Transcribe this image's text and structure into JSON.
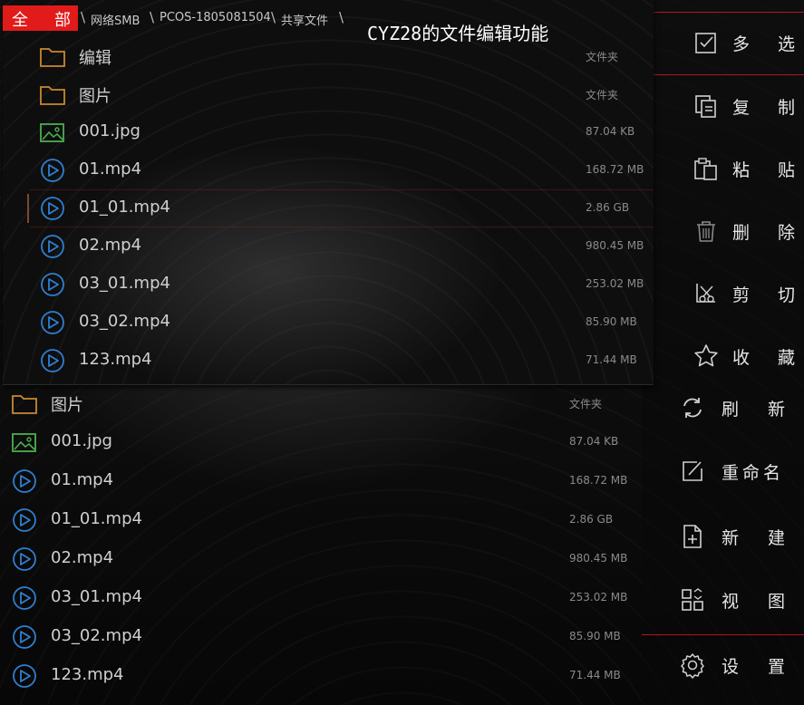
{
  "headline": "CYZ28的文件编辑功能",
  "breadcrumb": {
    "all_label_1": "全",
    "all_label_2": "部",
    "separator": "\\",
    "parts": [
      "网络SMB",
      "PCOS-1805081504",
      "共享文件"
    ]
  },
  "front_list": [
    {
      "icon": "folder-icon",
      "name": "编辑",
      "meta": "文件夹"
    },
    {
      "icon": "folder-icon",
      "name": "图片",
      "meta": "文件夹"
    },
    {
      "icon": "image-icon",
      "name": "001.jpg",
      "meta": "87.04 KB"
    },
    {
      "icon": "play-icon",
      "name": "01.mp4",
      "meta": "168.72 MB"
    },
    {
      "icon": "play-icon",
      "name": "01_01.mp4",
      "meta": "2.86 GB"
    },
    {
      "icon": "play-icon",
      "name": "02.mp4",
      "meta": "980.45 MB"
    },
    {
      "icon": "play-icon",
      "name": "03_01.mp4",
      "meta": "253.02 MB"
    },
    {
      "icon": "play-icon",
      "name": "03_02.mp4",
      "meta": "85.90 MB"
    },
    {
      "icon": "play-icon",
      "name": "123.mp4",
      "meta": "71.44 MB"
    }
  ],
  "back_list": [
    {
      "icon": "folder-icon",
      "name": "图片",
      "meta": "文件夹"
    },
    {
      "icon": "image-icon",
      "name": "001.jpg",
      "meta": "87.04 KB"
    },
    {
      "icon": "play-icon",
      "name": "01.mp4",
      "meta": "168.72 MB"
    },
    {
      "icon": "play-icon",
      "name": "01_01.mp4",
      "meta": "2.86 GB"
    },
    {
      "icon": "play-icon",
      "name": "02.mp4",
      "meta": "980.45 MB"
    },
    {
      "icon": "play-icon",
      "name": "03_01.mp4",
      "meta": "253.02 MB"
    },
    {
      "icon": "play-icon",
      "name": "03_02.mp4",
      "meta": "85.90 MB"
    },
    {
      "icon": "play-icon",
      "name": "123.mp4",
      "meta": "71.44 MB"
    }
  ],
  "menu_top": [
    {
      "icon": "checkbox-icon",
      "c1": "多",
      "c2": "选"
    },
    {
      "icon": "copy-icon",
      "c1": "复",
      "c2": "制"
    },
    {
      "icon": "paste-icon",
      "c1": "粘",
      "c2": "贴"
    },
    {
      "icon": "trash-icon",
      "c1": "删",
      "c2": "除"
    },
    {
      "icon": "scissors-icon",
      "c1": "剪",
      "c2": "切"
    },
    {
      "icon": "star-icon",
      "c1": "收",
      "c2": "藏"
    }
  ],
  "menu_bottom": [
    {
      "icon": "refresh-icon",
      "c1": "刷",
      "c2": "新"
    },
    {
      "icon": "rename-icon",
      "c1": "重命名",
      "c2": ""
    },
    {
      "icon": "new-file-icon",
      "c1": "新",
      "c2": "建"
    },
    {
      "icon": "view-icon",
      "c1": "视",
      "c2": "图"
    },
    {
      "icon": "gear-icon",
      "c1": "设",
      "c2": "置"
    }
  ],
  "colors": {
    "accent_red": "#e11a1a",
    "folder": "#c9892f",
    "image": "#4caf50",
    "play": "#2f7fd0",
    "text": "#d0d0d0",
    "meta": "#8a8a8a"
  }
}
